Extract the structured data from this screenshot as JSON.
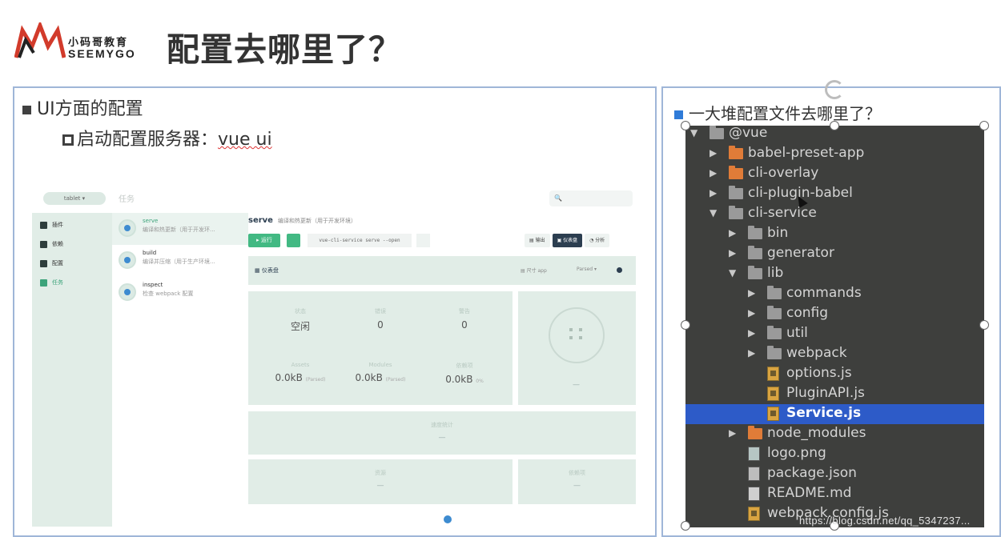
{
  "header": {
    "logo_cn": "小码哥教育",
    "logo_en": "SEEMYGO",
    "title": "配置去哪里了？"
  },
  "left": {
    "bullet1": "UI方面的配置",
    "bullet2_prefix": "启动配置服务器：",
    "bullet2_code": "vue ui",
    "vueui": {
      "project": "tablet ▾",
      "page_title": "任务",
      "search": "🔍",
      "nav": [
        "插件",
        "依赖",
        "配置",
        "任务"
      ],
      "tasks": [
        {
          "name": "serve",
          "desc": "编译和热更新（用于开发环..."
        },
        {
          "name": "build",
          "desc": "编译并压缩（用于生产环境..."
        },
        {
          "name": "inspect",
          "desc": "检查 webpack 配置"
        }
      ],
      "serve_title": "serve",
      "serve_sub": "编译和热更新（用于开发环境）",
      "run_btn": "▸ 运行",
      "cmd": "vue-cli-service serve --open",
      "tabs": [
        "▤ 输出",
        "▣ 仪表盘",
        "◔ 分析"
      ],
      "dash_label": "▦ 仪表盘",
      "dash_r1": "▤ 尺寸 app",
      "dash_r2": "Parsed ▾",
      "stats": [
        {
          "k": "状态",
          "v": "空闲"
        },
        {
          "k": "错误",
          "v": "0"
        },
        {
          "k": "警告",
          "v": "0"
        },
        {
          "k": "Assets",
          "v": "0.0kB",
          "u": "(Parsed)"
        },
        {
          "k": "Modules",
          "v": "0.0kB",
          "u": "(Parsed)"
        },
        {
          "k": "依赖项",
          "v": "0.0kB",
          "u": "0%"
        }
      ],
      "circle_dash": "—",
      "speed_k": "速度统计",
      "speed_v": "—",
      "bot1_k": "资源",
      "bot1_v": "—",
      "bot2_k": "依赖项",
      "bot2_v": "—"
    }
  },
  "right": {
    "bullet": "一大堆配置文件去哪里了？",
    "tree": [
      {
        "label": "@vue",
        "arrow": "▼",
        "icon": "grey",
        "depth": 0
      },
      {
        "label": "babel-preset-app",
        "arrow": "▶",
        "icon": "orange",
        "depth": 1
      },
      {
        "label": "cli-overlay",
        "arrow": "▶",
        "icon": "orange",
        "depth": 1
      },
      {
        "label": "cli-plugin-babel",
        "arrow": "▶",
        "icon": "grey",
        "depth": 1
      },
      {
        "label": "cli-service",
        "arrow": "▼",
        "icon": "grey",
        "depth": 1
      },
      {
        "label": "bin",
        "arrow": "▶",
        "icon": "grey",
        "depth": 2
      },
      {
        "label": "generator",
        "arrow": "▶",
        "icon": "grey",
        "depth": 2
      },
      {
        "label": "lib",
        "arrow": "▼",
        "icon": "grey",
        "depth": 2
      },
      {
        "label": "commands",
        "arrow": "▶",
        "icon": "grey",
        "depth": 3
      },
      {
        "label": "config",
        "arrow": "▶",
        "icon": "grey",
        "depth": 3
      },
      {
        "label": "util",
        "arrow": "▶",
        "icon": "grey",
        "depth": 3
      },
      {
        "label": "webpack",
        "arrow": "▶",
        "icon": "grey",
        "depth": 3
      },
      {
        "label": "options.js",
        "arrow": "",
        "icon": "js",
        "depth": 3
      },
      {
        "label": "PluginAPI.js",
        "arrow": "",
        "icon": "js",
        "depth": 3
      },
      {
        "label": "Service.js",
        "arrow": "",
        "icon": "js",
        "depth": 3,
        "selected": true
      },
      {
        "label": "node_modules",
        "arrow": "▶",
        "icon": "orange",
        "depth": 2
      },
      {
        "label": "logo.png",
        "arrow": "",
        "icon": "img",
        "depth": 2
      },
      {
        "label": "package.json",
        "arrow": "",
        "icon": "json",
        "depth": 2
      },
      {
        "label": "README.md",
        "arrow": "",
        "icon": "md",
        "depth": 2
      },
      {
        "label": "webpack.config.js",
        "arrow": "",
        "icon": "js",
        "depth": 2
      }
    ]
  },
  "watermark": "https://blog.csdn.net/qq_5347237..."
}
